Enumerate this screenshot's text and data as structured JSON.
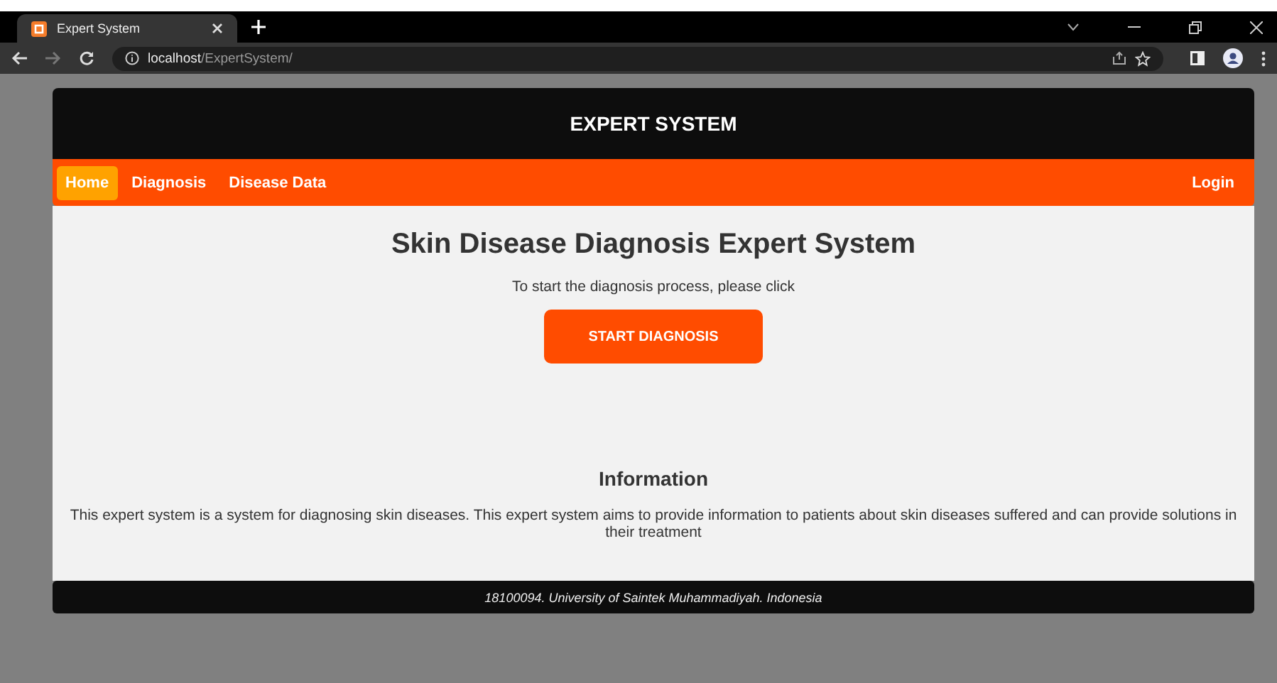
{
  "browser": {
    "tabs": [
      {
        "title": "Expert System",
        "selected": true
      }
    ],
    "address": {
      "host": "localhost",
      "path": "/ExpertSystem/"
    }
  },
  "header": {
    "title": "EXPERT SYSTEM"
  },
  "nav": {
    "items": [
      {
        "label": "Home",
        "selected": true
      },
      {
        "label": "Diagnosis",
        "selected": false
      },
      {
        "label": "Disease Data",
        "selected": false
      }
    ],
    "login": "Login"
  },
  "main": {
    "heading": "Skin Disease Diagnosis Expert System",
    "prompt": "To start the diagnosis process, please click",
    "button": "START DIAGNOSIS"
  },
  "information": {
    "heading": "Information",
    "text": "This expert system is a system for diagnosing skin diseases. This expert system aims to provide information to patients about skin diseases suffered and can provide solutions in their treatment"
  },
  "footer": {
    "text": "18100094. University of Saintek Muhammadiyah. Indonesia"
  }
}
